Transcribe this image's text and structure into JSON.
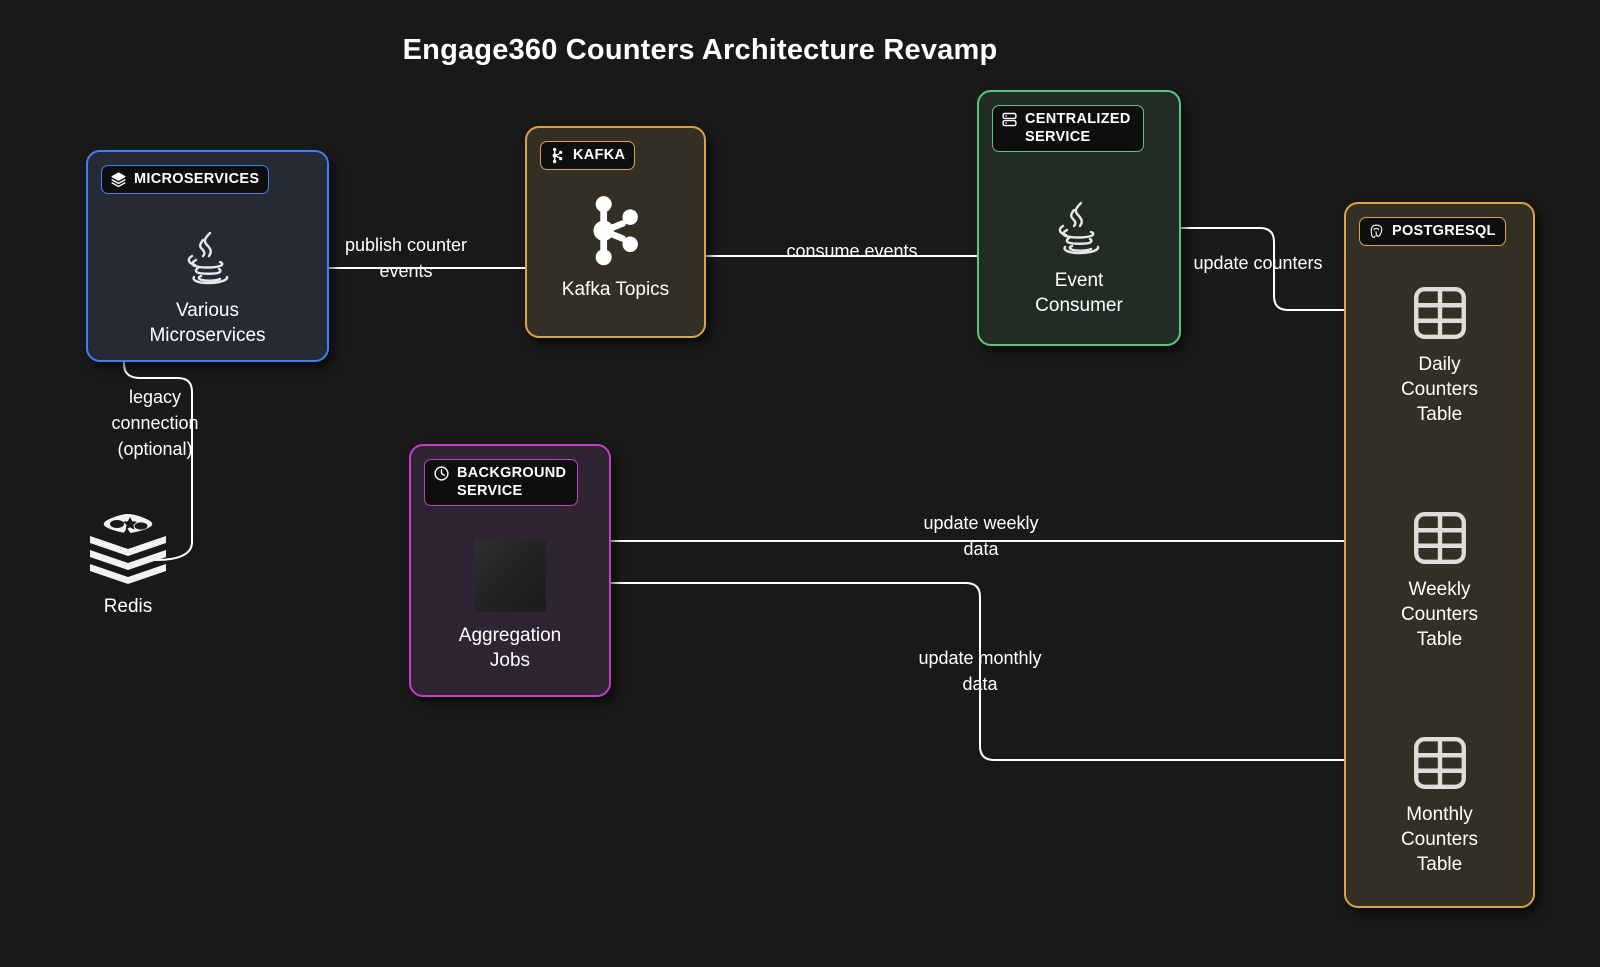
{
  "diagram": {
    "title": "Engage360 Counters Architecture Revamp",
    "background_color": "#191919"
  },
  "nodes": [
    {
      "id": "microservices",
      "badge_label": "MICROSERVICES",
      "badge_icon": "layers-icon",
      "main_icon": "java-icon",
      "label": "Various\nMicroservices",
      "accent_color": "#3b82f6",
      "fill_color": "#252a35"
    },
    {
      "id": "kafka",
      "badge_label": "KAFKA",
      "badge_icon": "kafka-icon",
      "main_icon": "kafka-icon",
      "label": "Kafka Topics",
      "accent_color": "#d9a441",
      "fill_color": "#332f25"
    },
    {
      "id": "centralized",
      "badge_label": "CENTRALIZED SERVICE",
      "badge_icon": "server-icon",
      "main_icon": "java-icon",
      "label": "Event\nConsumer",
      "accent_color": "#55c97f",
      "fill_color": "#222b24"
    },
    {
      "id": "background",
      "badge_label": "BACKGROUND SERVICE",
      "badge_icon": "clock-icon",
      "main_icon": "broken-image-placeholder",
      "label": "Aggregation\nJobs",
      "accent_color": "#c23ec2",
      "fill_color": "#2e2433"
    },
    {
      "id": "postgres",
      "badge_label": "POSTGRESQL",
      "badge_icon": "postgresql-elephant-icon",
      "accent_color": "#d9a441",
      "fill_color": "#332f25",
      "tables": [
        {
          "id": "daily",
          "icon": "table-icon",
          "label": "Daily\nCounters\nTable"
        },
        {
          "id": "weekly",
          "icon": "table-icon",
          "label": "Weekly\nCounters\nTable"
        },
        {
          "id": "monthly",
          "icon": "table-icon",
          "label": "Monthly\nCounters\nTable"
        }
      ]
    },
    {
      "id": "redis",
      "main_icon": "redis-icon",
      "label": "Redis",
      "fill_color": "#191919"
    }
  ],
  "edges": [
    {
      "id": "publish",
      "label": "publish counter\nevents",
      "from": "microservices",
      "to": "kafka"
    },
    {
      "id": "consume",
      "label": "consume events",
      "from": "kafka",
      "to": "centralized"
    },
    {
      "id": "update-counters",
      "label": "update counters",
      "from": "centralized",
      "to": "daily"
    },
    {
      "id": "legacy",
      "label": "legacy\nconnection\n(optional)",
      "from": "redis",
      "to": "microservices"
    },
    {
      "id": "update-weekly",
      "label": "update weekly\ndata",
      "from": "background",
      "to": "weekly"
    },
    {
      "id": "update-monthly",
      "label": "update monthly\ndata",
      "from": "background",
      "to": "monthly"
    }
  ]
}
